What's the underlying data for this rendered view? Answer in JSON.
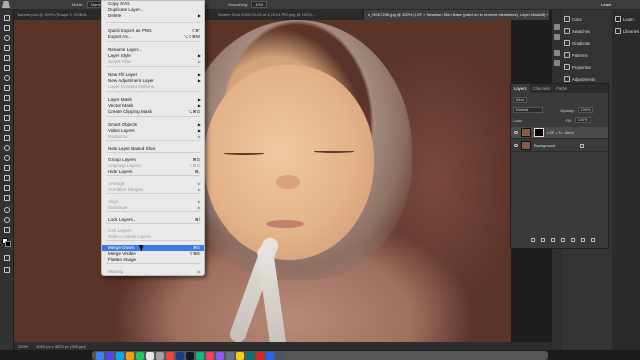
{
  "options_bar": {
    "mode_label": "Mode:",
    "mode_value": "Normal",
    "smoothing_label": "Smoothing:",
    "smoothing_value": "10%",
    "learn_label": "Learn"
  },
  "tabs": [
    {
      "label": "banner.psd @ 100% (Shape 3, RGB/8...",
      "active": false
    },
    {
      "label": "Screen Shot 2020-03-28 at 4.25.24 PM.png @ 100%...",
      "active": false
    },
    {
      "label": "s_NSK7298.jpg @ 200% (LSF > Newborn Skin Base (paint on to remove blemishes), Layer Mask/8) *",
      "active": true
    }
  ],
  "layer_menu": {
    "items": [
      {
        "label": "Copy SVG",
        "shortcut": "",
        "disabled": false,
        "submenu": false
      },
      {
        "label": "Duplicate Layer...",
        "shortcut": "",
        "disabled": false,
        "submenu": false
      },
      {
        "label": "Delete",
        "shortcut": "",
        "disabled": false,
        "submenu": true
      },
      {
        "label": "Quick Export as PNG",
        "shortcut": "⇧⌘'",
        "disabled": false,
        "submenu": false
      },
      {
        "label": "Export As...",
        "shortcut": "⌥⇧⌘W",
        "disabled": false,
        "submenu": false
      },
      {
        "label": "Rename Layer...",
        "shortcut": "",
        "disabled": false,
        "submenu": false
      },
      {
        "label": "Layer Style",
        "shortcut": "",
        "disabled": false,
        "submenu": true
      },
      {
        "label": "Smart Filter",
        "shortcut": "",
        "disabled": true,
        "submenu": true
      },
      {
        "label": "New Fill Layer",
        "shortcut": "",
        "disabled": false,
        "submenu": true
      },
      {
        "label": "New Adjustment Layer",
        "shortcut": "",
        "disabled": false,
        "submenu": true
      },
      {
        "label": "Layer Content Options...",
        "shortcut": "",
        "disabled": true,
        "submenu": false
      },
      {
        "label": "Layer Mask",
        "shortcut": "",
        "disabled": false,
        "submenu": true
      },
      {
        "label": "Vector Mask",
        "shortcut": "",
        "disabled": false,
        "submenu": true
      },
      {
        "label": "Create Clipping Mask",
        "shortcut": "⌥⌘G",
        "disabled": false,
        "submenu": false
      },
      {
        "label": "Smart Objects",
        "shortcut": "",
        "disabled": false,
        "submenu": true
      },
      {
        "label": "Video Layers",
        "shortcut": "",
        "disabled": false,
        "submenu": true
      },
      {
        "label": "Rasterize",
        "shortcut": "",
        "disabled": true,
        "submenu": true
      },
      {
        "label": "New Layer Based Slice",
        "shortcut": "",
        "disabled": false,
        "submenu": false
      },
      {
        "label": "Group Layers",
        "shortcut": "⌘G",
        "disabled": false,
        "submenu": false
      },
      {
        "label": "Ungroup Layers",
        "shortcut": "⇧⌘G",
        "disabled": true,
        "submenu": false
      },
      {
        "label": "Hide Layers",
        "shortcut": "⌘,",
        "disabled": false,
        "submenu": false
      },
      {
        "label": "Arrange",
        "shortcut": "",
        "disabled": true,
        "submenu": true
      },
      {
        "label": "Combine Shapes",
        "shortcut": "",
        "disabled": true,
        "submenu": true
      },
      {
        "label": "Align",
        "shortcut": "",
        "disabled": true,
        "submenu": true
      },
      {
        "label": "Distribute",
        "shortcut": "",
        "disabled": true,
        "submenu": true
      },
      {
        "label": "Lock Layers...",
        "shortcut": "⌘/",
        "disabled": false,
        "submenu": false
      },
      {
        "label": "Link Layers",
        "shortcut": "",
        "disabled": true,
        "submenu": false
      },
      {
        "label": "Select Linked Layers",
        "shortcut": "",
        "disabled": true,
        "submenu": false
      },
      {
        "label": "Merge Down",
        "shortcut": "⌘E",
        "disabled": false,
        "submenu": false,
        "highlighted": true
      },
      {
        "label": "Merge Visible",
        "shortcut": "⇧⌘E",
        "disabled": false,
        "submenu": false
      },
      {
        "label": "Flatten Image",
        "shortcut": "",
        "disabled": false,
        "submenu": false
      },
      {
        "label": "Matting",
        "shortcut": "",
        "disabled": true,
        "submenu": true
      }
    ]
  },
  "right_dock": {
    "items": [
      "Color",
      "Swatches",
      "Gradients",
      "Patterns",
      "Properties",
      "Adjustments"
    ],
    "learn_items": [
      "Learn",
      "Libraries"
    ]
  },
  "layers_panel": {
    "tabs": [
      "Layers",
      "Channels",
      "Paths"
    ],
    "kind_label": "Kind",
    "blend_mode": "Normal",
    "opacity_label": "Opacity:",
    "opacity_value": "100%",
    "lock_label": "Lock:",
    "fill_label": "Fill:",
    "fill_value": "100%",
    "layers": [
      {
        "name": "LSF > N...blem",
        "selected": true
      },
      {
        "name": "Background",
        "selected": false
      }
    ]
  },
  "status": {
    "zoom": "200%",
    "doc_size": "3000 px x 3870 px (300 ppi)"
  }
}
